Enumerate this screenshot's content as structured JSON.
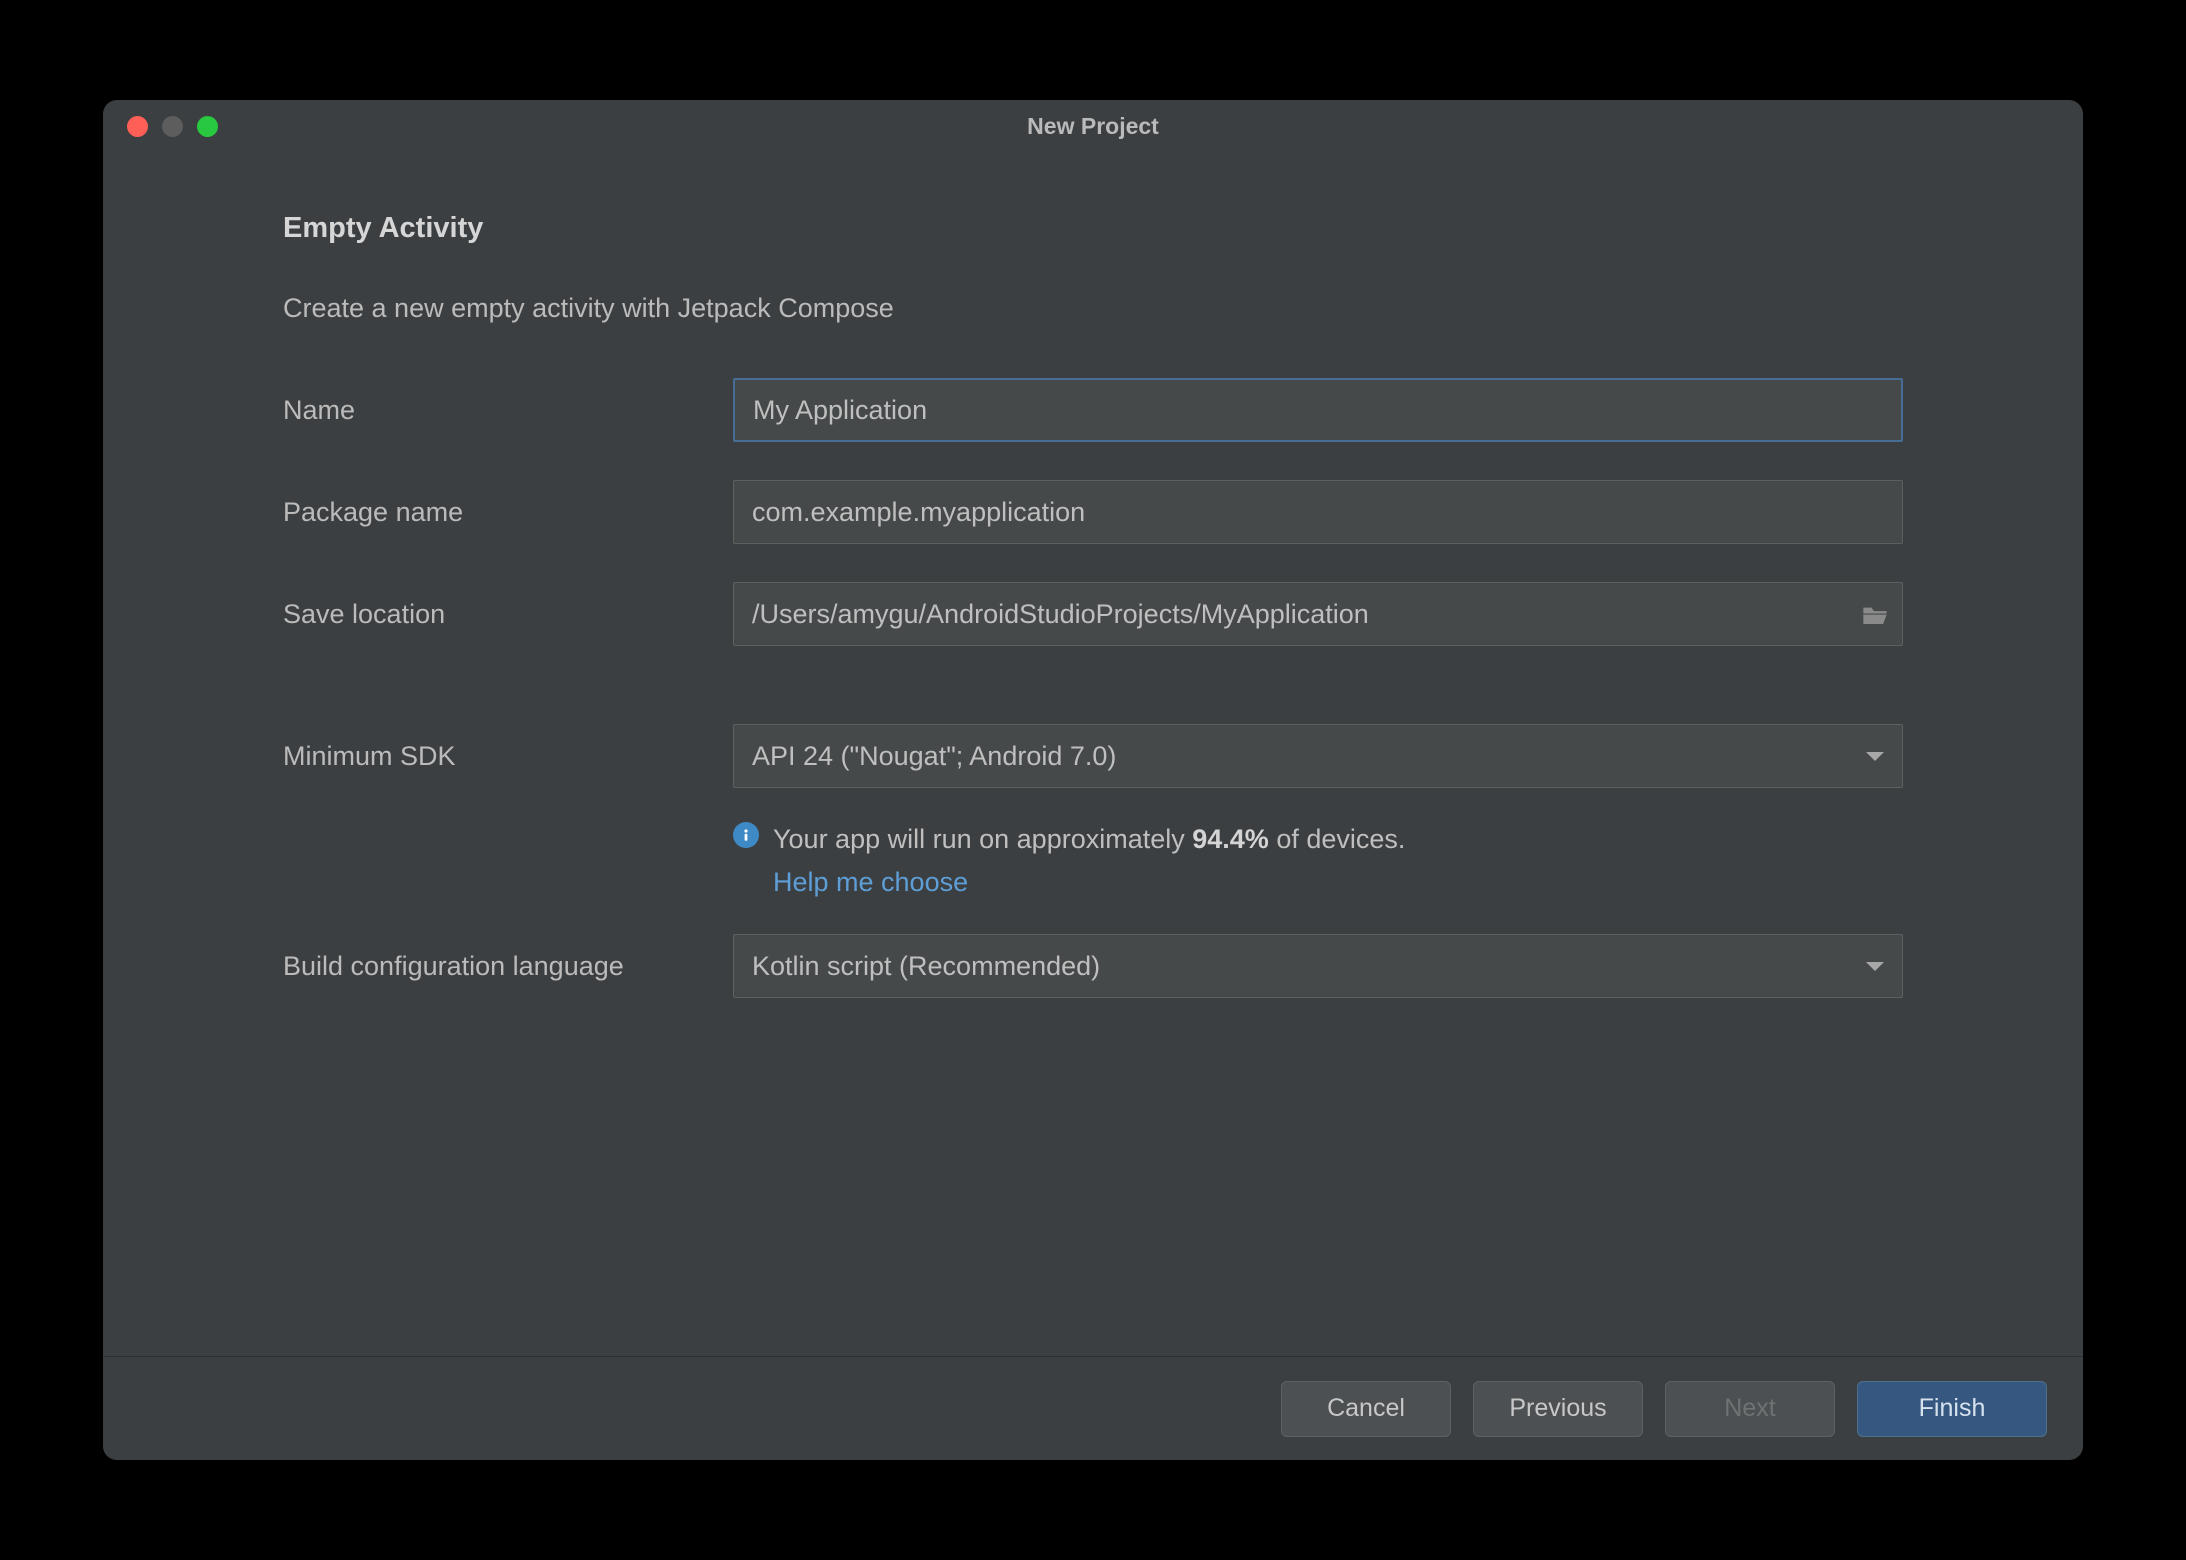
{
  "window": {
    "title": "New Project"
  },
  "page": {
    "heading": "Empty Activity",
    "subheading": "Create a new empty activity with Jetpack Compose"
  },
  "form": {
    "name": {
      "label": "Name",
      "value": "My Application"
    },
    "package": {
      "label": "Package name",
      "value": "com.example.myapplication"
    },
    "location": {
      "label": "Save location",
      "value": "/Users/amygu/AndroidStudioProjects/MyApplication"
    },
    "minsdk": {
      "label": "Minimum SDK",
      "value": "API 24 (\"Nougat\"; Android 7.0)"
    },
    "info": {
      "prefix": "Your app will run on approximately ",
      "percent": "94.4%",
      "suffix": " of devices.",
      "help": "Help me choose"
    },
    "buildcfg": {
      "label": "Build configuration language",
      "value": "Kotlin script (Recommended)"
    }
  },
  "footer": {
    "cancel": "Cancel",
    "previous": "Previous",
    "next": "Next",
    "finish": "Finish"
  }
}
